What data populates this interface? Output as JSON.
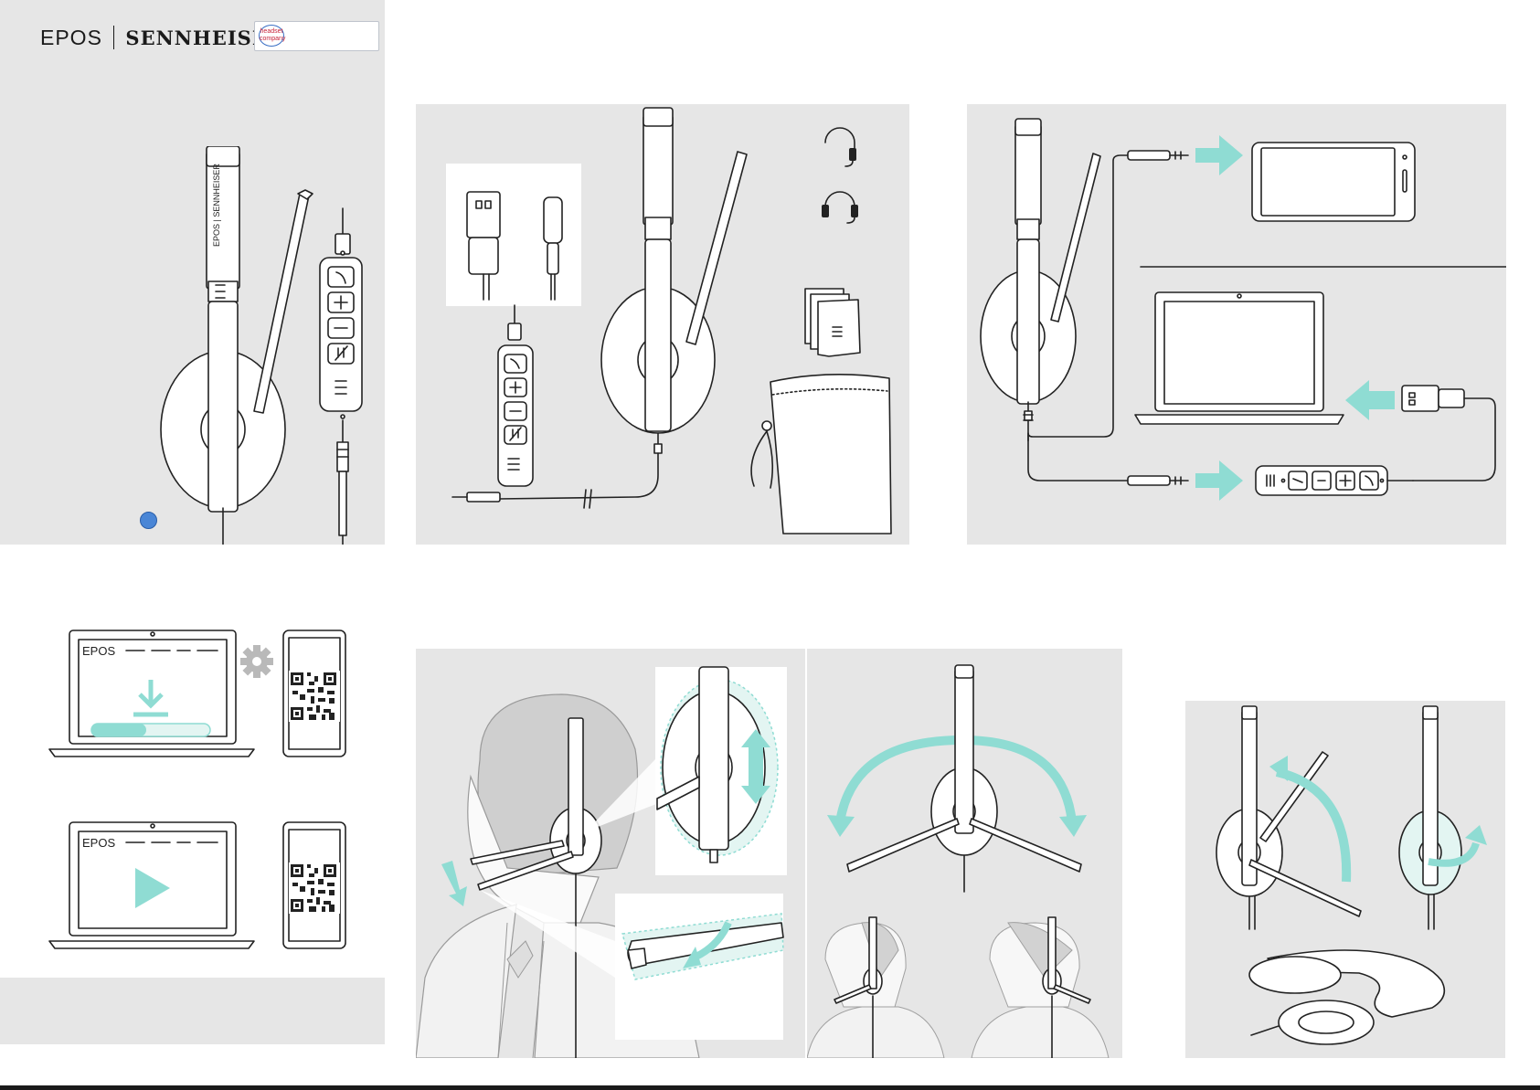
{
  "brand": {
    "epos": "EPOS",
    "sennheiser": "SENNHEISER",
    "partner_lines": [
      "headset",
      "company"
    ]
  },
  "product_illustration": {
    "headband_text": "EPOS | SENNHEISER",
    "inline_buttons": [
      "call-icon",
      "plus-icon",
      "minus-icon",
      "mic-mute-icon",
      "epos-logo-icon"
    ]
  },
  "software": {
    "laptop_brand": "EPOS",
    "icons": [
      "download-icon",
      "gear-icon",
      "qr-code",
      "play-icon"
    ]
  },
  "colors": {
    "panel": "#e6e6e6",
    "accent": "#8fdcd3",
    "line": "#222222",
    "status_dot": "#4a86d6"
  }
}
